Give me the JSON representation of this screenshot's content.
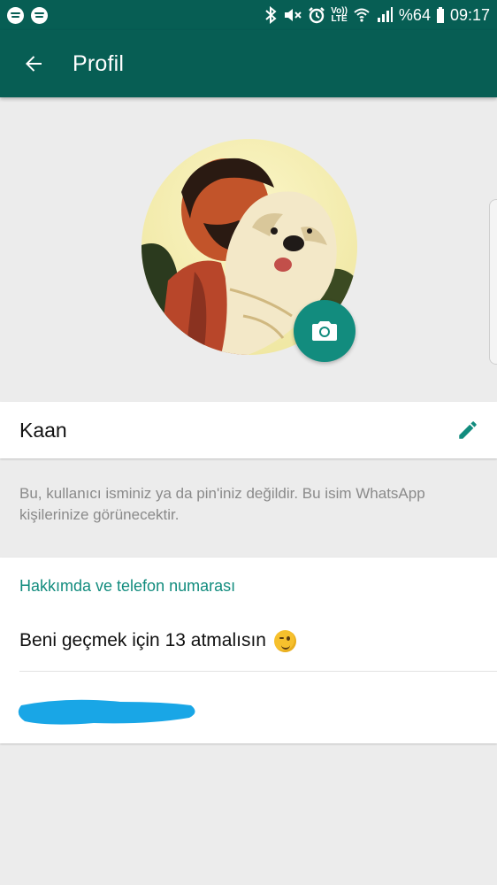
{
  "status_bar": {
    "left_icons": [
      "spotify-icon",
      "spotify-icon"
    ],
    "right_icons": [
      "bluetooth-icon",
      "mute-icon",
      "alarm-icon",
      "volte-icon",
      "wifi-icon",
      "signal-icon",
      "battery-icon"
    ],
    "volte_top": "Vo))",
    "volte_bottom": "LTE",
    "battery": "%64",
    "time": "09:17"
  },
  "app_bar": {
    "title": "Profil",
    "back_icon": "arrow-back-icon"
  },
  "profile": {
    "avatar_alt": "avatar",
    "camera_icon": "camera-icon"
  },
  "name": {
    "value": "Kaan",
    "edit_icon": "pencil-icon"
  },
  "name_hint": "Bu, kullanıcı isminiz ya da pin'iniz değildir. Bu isim WhatsApp kişilerinize görünecektir.",
  "about": {
    "section_title": "Hakkımda ve telefon numarası",
    "status_text": "Beni geçmek için 13 atmalısın",
    "status_emoji": "winking-face"
  },
  "colors": {
    "primary": "#075e54",
    "accent": "#128c7e",
    "redaction": "#19a6e6",
    "background": "#ececec"
  }
}
